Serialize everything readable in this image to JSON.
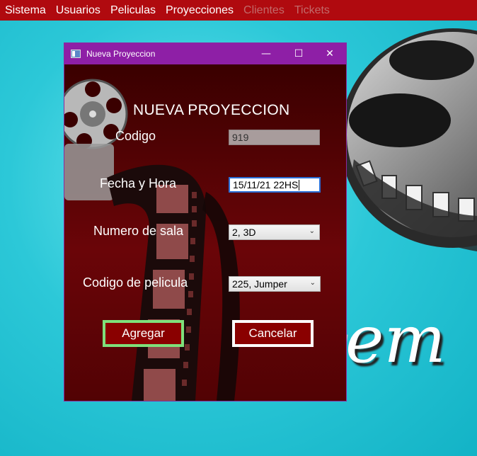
{
  "menu": {
    "items": [
      {
        "label": "Sistema",
        "enabled": true
      },
      {
        "label": "Usuarios",
        "enabled": true
      },
      {
        "label": "Peliculas",
        "enabled": true
      },
      {
        "label": "Proyecciones",
        "enabled": true
      },
      {
        "label": "Clientes",
        "enabled": false
      },
      {
        "label": "Tickets",
        "enabled": false
      }
    ]
  },
  "background": {
    "partial_text": "em"
  },
  "dialog": {
    "title": "Nueva Proyeccion",
    "minimize_glyph": "—",
    "maximize_glyph": "☐",
    "close_glyph": "✕",
    "heading": "NUEVA PROYECCION",
    "fields": {
      "codigo": {
        "label": "Codigo",
        "value": "919"
      },
      "fecha": {
        "label": "Fecha y Hora",
        "value": "15/11/21 22HS"
      },
      "sala": {
        "label": "Numero de sala",
        "value": "2, 3D"
      },
      "pelicula": {
        "label": "Codigo de pelicula",
        "value": "225, Jumper"
      }
    },
    "combo_arrow_glyph": "⌄",
    "buttons": {
      "agregar": "Agregar",
      "cancelar": "Cancelar"
    }
  },
  "colors": {
    "menubar": "#b00a0f",
    "titlebar": "#8e1fa6",
    "agregar_border": "#7fe07a",
    "button_fill": "#8a0000"
  }
}
